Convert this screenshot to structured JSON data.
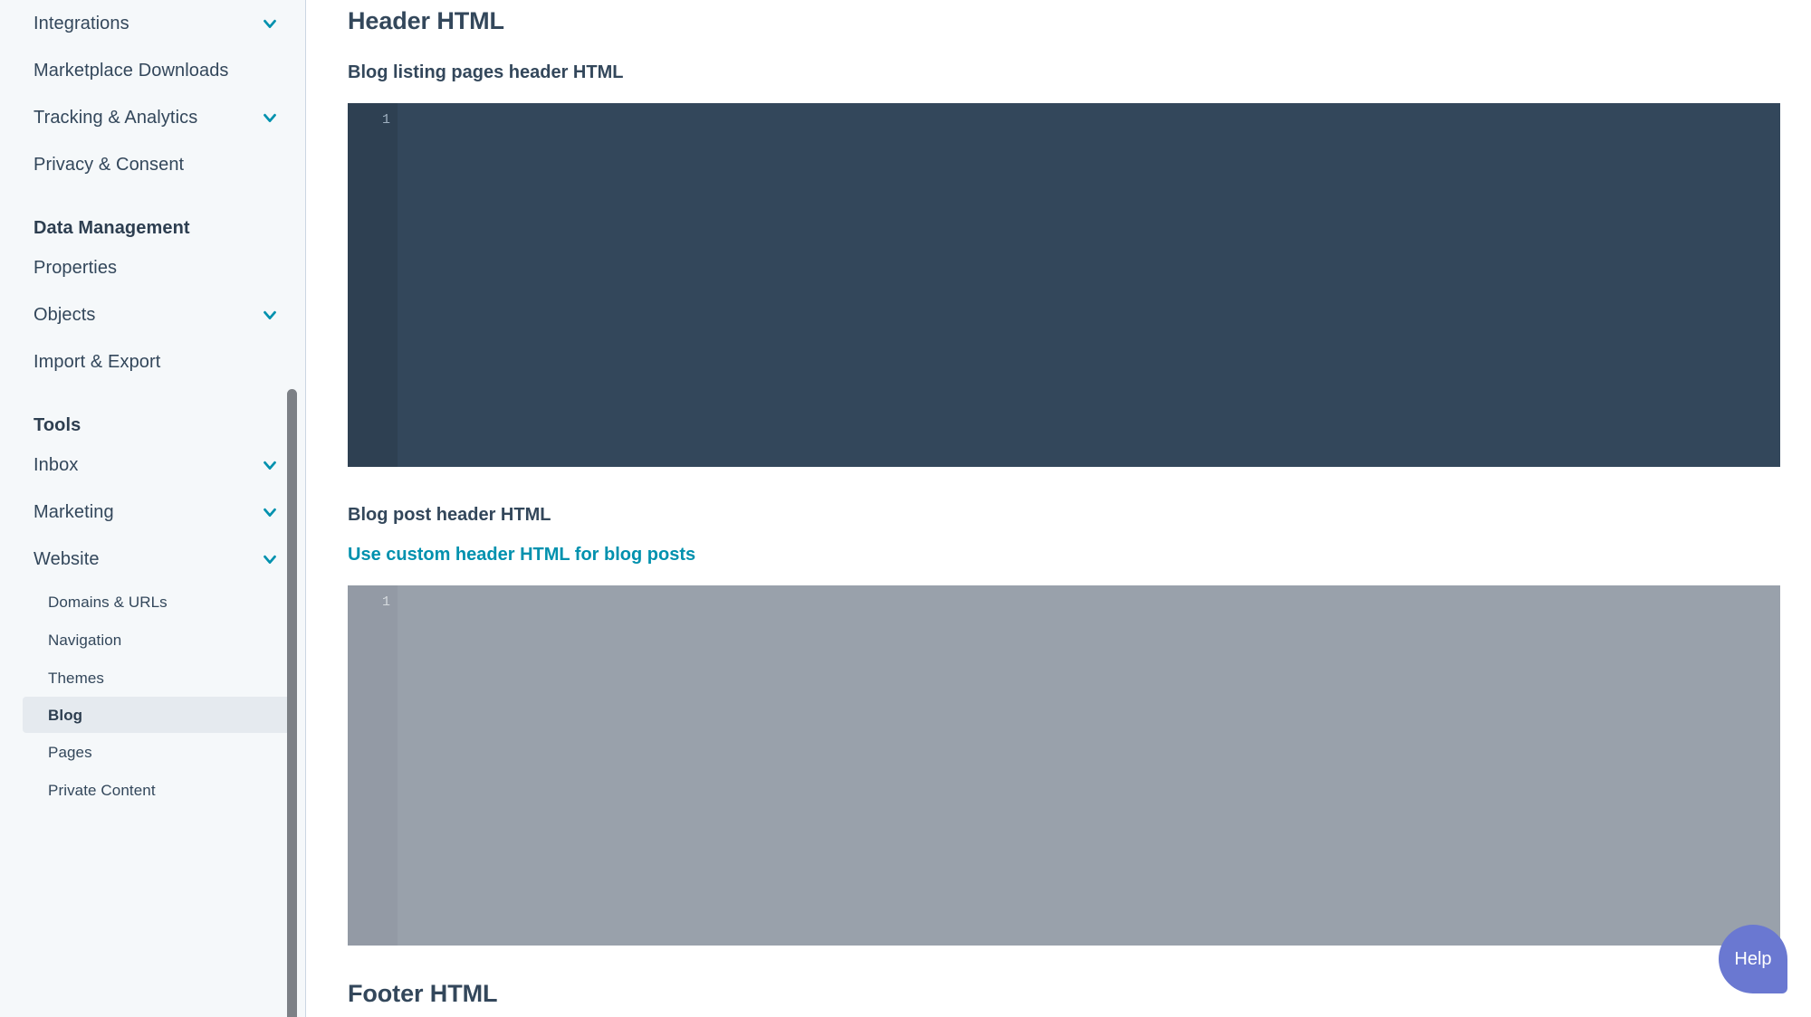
{
  "sidebar": {
    "scrollbar": {
      "name": "sidebar-scrollbar"
    },
    "items": [
      {
        "label": "Integrations",
        "type": "parent",
        "chevron": "chevron-down-icon",
        "name": "sidebar-item-integrations"
      },
      {
        "label": "Marketplace Downloads",
        "type": "parent",
        "chevron": "",
        "name": "sidebar-item-marketplace-downloads"
      },
      {
        "label": "Tracking & Analytics",
        "type": "parent",
        "chevron": "chevron-down-icon",
        "name": "sidebar-item-tracking-analytics"
      },
      {
        "label": "Privacy & Consent",
        "type": "parent",
        "chevron": "",
        "name": "sidebar-item-privacy-consent"
      },
      {
        "label": "Data Management",
        "type": "section",
        "chevron": "",
        "name": "sidebar-section-data-management"
      },
      {
        "label": "Properties",
        "type": "parent",
        "chevron": "",
        "name": "sidebar-item-properties"
      },
      {
        "label": "Objects",
        "type": "parent",
        "chevron": "chevron-down-icon",
        "name": "sidebar-item-objects"
      },
      {
        "label": "Import & Export",
        "type": "parent",
        "chevron": "",
        "name": "sidebar-item-import-export"
      },
      {
        "label": "Tools",
        "type": "section",
        "chevron": "",
        "name": "sidebar-section-tools"
      },
      {
        "label": "Inbox",
        "type": "parent",
        "chevron": "chevron-down-icon",
        "name": "sidebar-item-inbox"
      },
      {
        "label": "Marketing",
        "type": "parent",
        "chevron": "chevron-down-icon",
        "name": "sidebar-item-marketing"
      },
      {
        "label": "Website",
        "type": "parent",
        "chevron": "chevron-down-icon",
        "name": "sidebar-item-website"
      },
      {
        "label": "Domains & URLs",
        "type": "child",
        "chevron": "",
        "name": "sidebar-item-domains-urls"
      },
      {
        "label": "Navigation",
        "type": "child",
        "chevron": "",
        "name": "sidebar-item-navigation"
      },
      {
        "label": "Themes",
        "type": "child",
        "chevron": "",
        "name": "sidebar-item-themes"
      },
      {
        "label": "Blog",
        "type": "child",
        "chevron": "",
        "selected": true,
        "name": "sidebar-item-blog"
      },
      {
        "label": "Pages",
        "type": "child",
        "chevron": "",
        "name": "sidebar-item-pages"
      },
      {
        "label": "Private Content",
        "type": "child",
        "chevron": "",
        "name": "sidebar-item-private-content"
      }
    ]
  },
  "main": {
    "header_section": {
      "title": "Header HTML",
      "listing": {
        "label": "Blog listing pages header HTML",
        "editor": {
          "line_number": "1",
          "code": "",
          "state": "enabled"
        }
      },
      "post": {
        "label": "Blog post header HTML",
        "toggle_link": "Use custom header HTML for blog posts",
        "editor": {
          "line_number": "1",
          "code": "",
          "state": "disabled"
        }
      }
    },
    "footer_section": {
      "title": "Footer HTML"
    }
  },
  "help": {
    "label": "Help"
  },
  "colors": {
    "sidebar_bg": "#f5f8fa",
    "text_primary": "#33475b",
    "link_teal": "#0091ae",
    "chevron_teal": "#0091ae",
    "editor_dark": "#33475b",
    "editor_disabled": "#99a1ab",
    "help_purple": "#6a78d1",
    "selected_item_bg": "#e5eaef"
  }
}
